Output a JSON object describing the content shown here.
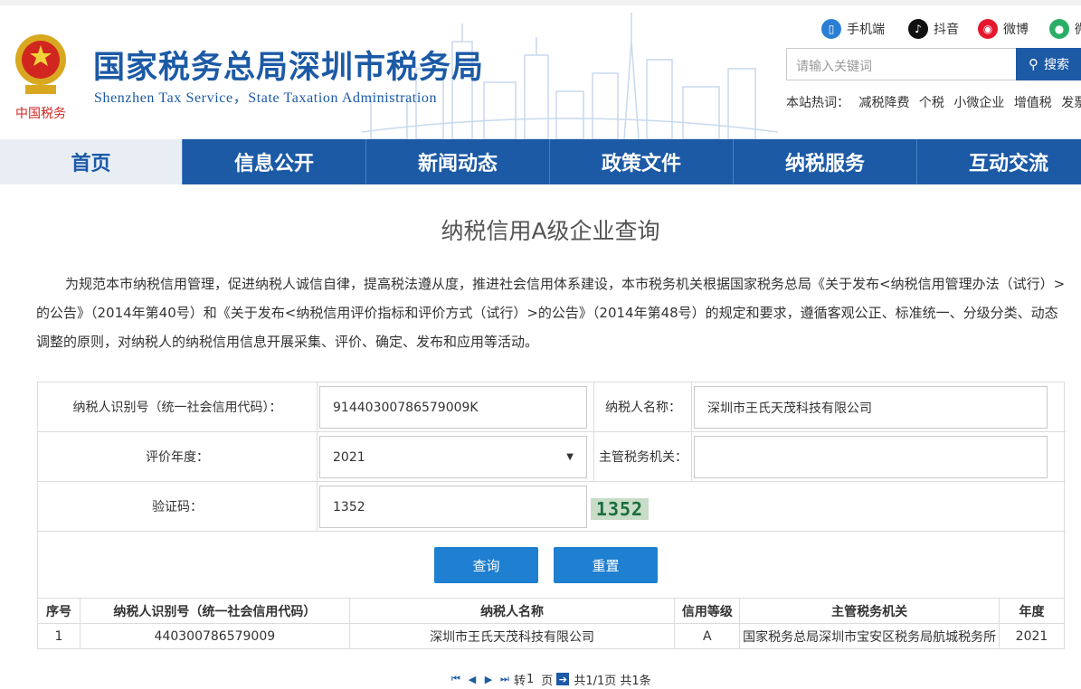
{
  "header": {
    "title_cn": "国家税务总局深圳市税务局",
    "title_en": "Shenzhen  Tax  Service，State Taxation  Administration",
    "emblem_text": "中国税务",
    "social": [
      {
        "label": "手机端",
        "icon": "mobile-icon",
        "color": "#2a7fd4"
      },
      {
        "label": "抖音",
        "icon": "douyin-icon",
        "color": "#111111"
      },
      {
        "label": "微博",
        "icon": "weibo-icon",
        "color": "#e6162d"
      },
      {
        "label": "微",
        "icon": "wechat-icon",
        "color": "#2aae67"
      }
    ],
    "search": {
      "placeholder": "请输入关键词",
      "button": "搜索"
    },
    "hot_label": "本站热词：",
    "hot_words": [
      "减税降费",
      "个税",
      "小微企业",
      "增值税",
      "发票"
    ]
  },
  "nav": [
    "首页",
    "信息公开",
    "新闻动态",
    "政策文件",
    "纳税服务",
    "互动交流"
  ],
  "main": {
    "title": "纳税信用A级企业查询",
    "intro": "为规范本市纳税信用管理，促进纳税人诚信自律，提高税法遵从度，推进社会信用体系建设，本市税务机关根据国家税务总局《关于发布<纳税信用管理办法（试行）>的公告》（2014年第40号）和《关于发布<纳税信用评价指标和评价方式（试行）>的公告》（2014年第48号）的规定和要求，遵循客观公正、标准统一、分级分类、动态调整的原则，对纳税人的纳税信用信息开展采集、评价、确定、发布和应用等活动。"
  },
  "form": {
    "taxpayer_id_label": "纳税人识别号（统一社会信用代码）：",
    "taxpayer_id_value": "91440300786579009K",
    "taxpayer_name_label": "纳税人名称：",
    "taxpayer_name_value": "深圳市王氏天茂科技有限公司",
    "year_label": "评价年度：",
    "year_value": "2021",
    "authority_label": "主管税务机关：",
    "authority_value": "",
    "captcha_label": "验证码：",
    "captcha_value": "1352",
    "captcha_image_text": "1352",
    "query_button": "查询",
    "reset_button": "重置"
  },
  "table": {
    "headers": [
      "序号",
      "纳税人识别号（统一社会信用代码）",
      "纳税人名称",
      "信用等级",
      "主管税务机关",
      "年度"
    ],
    "rows": [
      [
        "1",
        "440300786579009",
        "深圳市王氏天茂科技有限公司",
        "A",
        "国家税务总局深圳市宝安区税务局航城税务所",
        "2021"
      ]
    ]
  },
  "pager": {
    "goto_label": "转",
    "page_value": "1",
    "page_unit": "页",
    "summary": "共1/1页 共1条"
  }
}
